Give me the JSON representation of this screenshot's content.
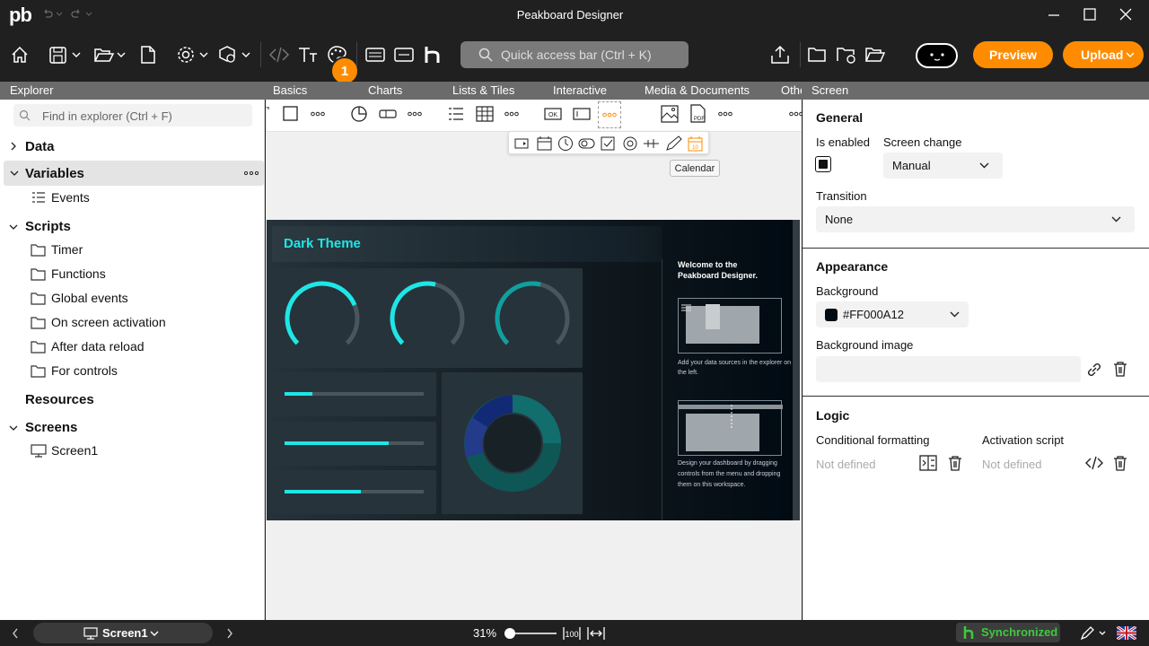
{
  "app": {
    "logo": "pb",
    "title": "Peakboard Designer"
  },
  "toolbar": {
    "badge": "1",
    "quick_access_placeholder": "Quick access bar (Ctrl + K)",
    "preview_label": "Preview",
    "upload_label": "Upload"
  },
  "tabs": {
    "explorer": "Explorer",
    "basics": "Basics",
    "charts": "Charts",
    "lists_tiles": "Lists & Tiles",
    "interactive": "Interactive",
    "media_documents": "Media & Documents",
    "others": "Othe",
    "screen": "Screen"
  },
  "explorer": {
    "search_placeholder": "Find in explorer (Ctrl + F)",
    "data": "Data",
    "variables": "Variables",
    "events": "Events",
    "scripts": "Scripts",
    "timer": "Timer",
    "functions": "Functions",
    "global_events": "Global events",
    "on_screen_activation": "On screen activation",
    "after_data_reload": "After data reload",
    "for_controls": "For controls",
    "resources": "Resources",
    "screens": "Screens",
    "screen1": "Screen1"
  },
  "canvas": {
    "tooltip": "Calendar",
    "preview_title": "Dark Theme",
    "welcome": "Welcome to the Peakboard Designer.",
    "hint1": "Add your data sources in the explorer on the left.",
    "hint2": "Design your dashboard by dragging controls from the menu and dropping them on this workspace.",
    "progress_bars": [
      0.2,
      0.75,
      0.55
    ],
    "gauges": [
      0.75,
      0.55,
      0.55
    ]
  },
  "properties": {
    "general": "General",
    "is_enabled": "Is enabled",
    "screen_change": "Screen change",
    "screen_change_value": "Manual",
    "transition": "Transition",
    "transition_value": "None",
    "appearance": "Appearance",
    "background": "Background",
    "background_value": "#FF000A12",
    "background_image": "Background image",
    "logic": "Logic",
    "conditional_formatting": "Conditional formatting",
    "activation_script": "Activation script",
    "not_defined_1": "Not defined",
    "not_defined_2": "Not defined"
  },
  "statusbar": {
    "screen": "Screen1",
    "zoom": "31%",
    "zoom_level": 0.31,
    "synchronized": "Synchronized"
  },
  "colors": {
    "accent": "#ff8c00",
    "canvas_bg": "#000a12",
    "cyan": "#1ee6e6",
    "sync_green": "#3ec93e"
  }
}
